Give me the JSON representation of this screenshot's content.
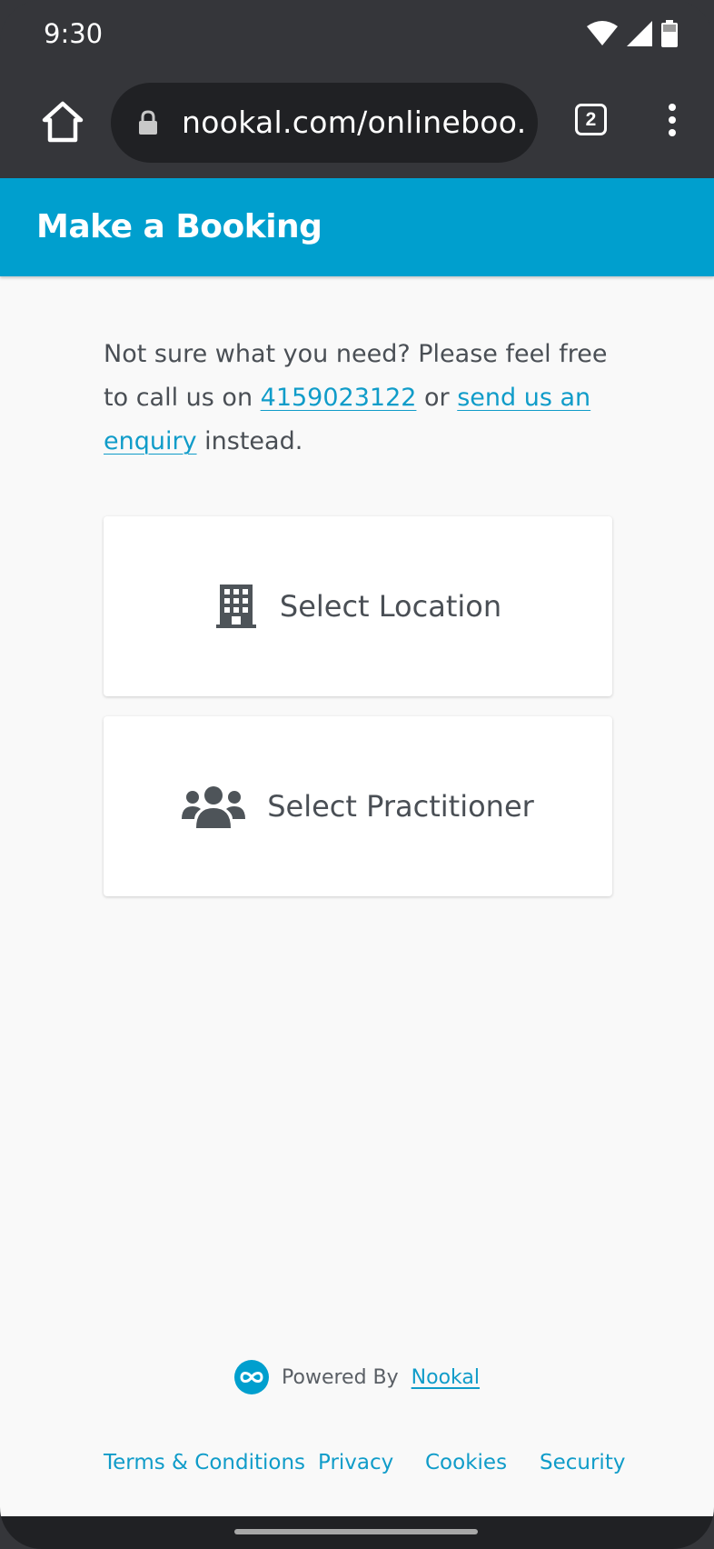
{
  "status_bar": {
    "time": "9:30",
    "icons": [
      "wifi-icon",
      "signal-icon",
      "battery-icon"
    ]
  },
  "browser": {
    "url": "nookal.com/onlineboo...",
    "tab_count": "2",
    "icons": [
      "home-icon",
      "lock-icon",
      "more-vert-icon"
    ]
  },
  "header": {
    "title": "Make a Booking",
    "color": "#009fce"
  },
  "intro": {
    "text_before": "Not sure what you need? Please feel free to call us on ",
    "phone": "4159023122",
    "text_middle": " or ",
    "enquiry_link": "send us an enquiry",
    "text_after": " instead."
  },
  "options": {
    "location": {
      "label": "Select Location",
      "icon": "building-icon"
    },
    "practitioner": {
      "label": "Select Practitioner",
      "icon": "users-icon"
    }
  },
  "powered_by": {
    "text": "Powered By",
    "link": "Nookal",
    "icon": "nookal-logo-icon"
  },
  "footer": {
    "terms": "Terms & Conditions",
    "privacy": "Privacy",
    "cookies": "Cookies",
    "security": "Security"
  },
  "colors": {
    "accent": "#009fce",
    "link": "#109cc9",
    "text": "#4a4f55",
    "page_background": "#f9f9f9"
  }
}
